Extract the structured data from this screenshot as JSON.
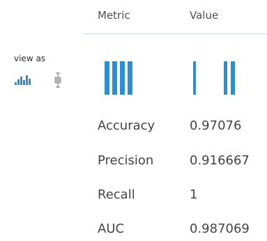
{
  "table": {
    "columns": [
      "Metric",
      "Value"
    ],
    "rows": [
      {
        "metric": "Accuracy",
        "value": "0.97076"
      },
      {
        "metric": "Precision",
        "value": "0.916667"
      },
      {
        "metric": "Recall",
        "value": "1"
      },
      {
        "metric": "AUC",
        "value": "0.987069"
      }
    ]
  },
  "view_as": {
    "label": "view as",
    "options": [
      {
        "icon": "histogram-icon",
        "selected": true
      },
      {
        "icon": "boxplot-icon",
        "selected": false
      }
    ]
  },
  "colors": {
    "accent": "#2b8fd0",
    "inactive_icon": "#9a9a9a",
    "header_rule": "#c9d3e6",
    "text": "#444444"
  }
}
